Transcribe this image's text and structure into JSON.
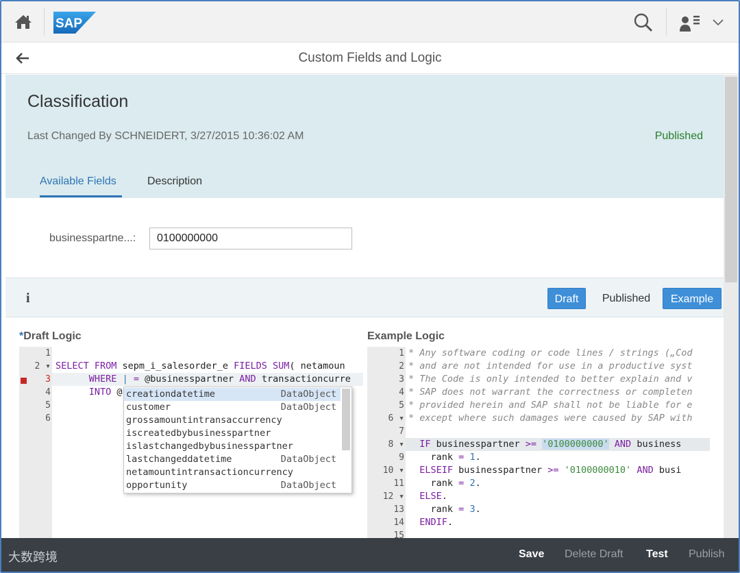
{
  "shell": {
    "logo_text": "SAP"
  },
  "page": {
    "title": "Custom Fields and Logic"
  },
  "header": {
    "object_title": "Classification",
    "last_changed": "Last Changed By SCHNEIDERT, 3/27/2015 10:36:02 AM",
    "status": "Published",
    "tabs": [
      {
        "label": "Available Fields",
        "active": true
      },
      {
        "label": "Description",
        "active": false
      }
    ]
  },
  "field": {
    "label": "businesspartne...:",
    "value": "0100000000"
  },
  "toolbar": {
    "info_icon": "i",
    "draft_label": "Draft",
    "published_label": "Published",
    "example_label": "Example"
  },
  "draft": {
    "label_star": "*",
    "label": "Draft Logic",
    "line_numbers": [
      "1",
      "2",
      "3",
      "4",
      "5",
      "6"
    ],
    "fold_markers": [
      "",
      "▾",
      "",
      "",
      "",
      ""
    ]
  },
  "autocomplete": {
    "items": [
      {
        "name": "creationdatetime",
        "type": "DataObject"
      },
      {
        "name": "customer",
        "type": "DataObject"
      },
      {
        "name": "grossamountintransaccurrency",
        "type": ""
      },
      {
        "name": "iscreatedbybusinesspartner",
        "type": ""
      },
      {
        "name": "islastchangedbybusinesspartner",
        "type": ""
      },
      {
        "name": "lastchangeddatetime",
        "type": "DataObject"
      },
      {
        "name": "netamountintransactioncurrency",
        "type": ""
      },
      {
        "name": "opportunity",
        "type": "DataObject"
      }
    ]
  },
  "example": {
    "label": "Example Logic",
    "line_numbers": [
      "1",
      "2",
      "3",
      "4",
      "5",
      "6",
      "7",
      "8",
      "9",
      "10",
      "11",
      "12",
      "13",
      "14",
      "15"
    ],
    "fold_markers": [
      "",
      "",
      "",
      "",
      "",
      "▾",
      "",
      "▾",
      "",
      "▾",
      "",
      "▾",
      "",
      "",
      ""
    ]
  },
  "footer": {
    "watermark": "大数跨境",
    "save": "Save",
    "delete_draft": "Delete Draft",
    "test": "Test",
    "publish": "Publish"
  },
  "colors": {
    "accent": "#2f74b5",
    "header_bg": "#dbebef",
    "button_blue": "#3e8fd8",
    "status_green": "#2b7d2b",
    "footer_bg": "#3a3f45",
    "error_red": "#c62828"
  }
}
